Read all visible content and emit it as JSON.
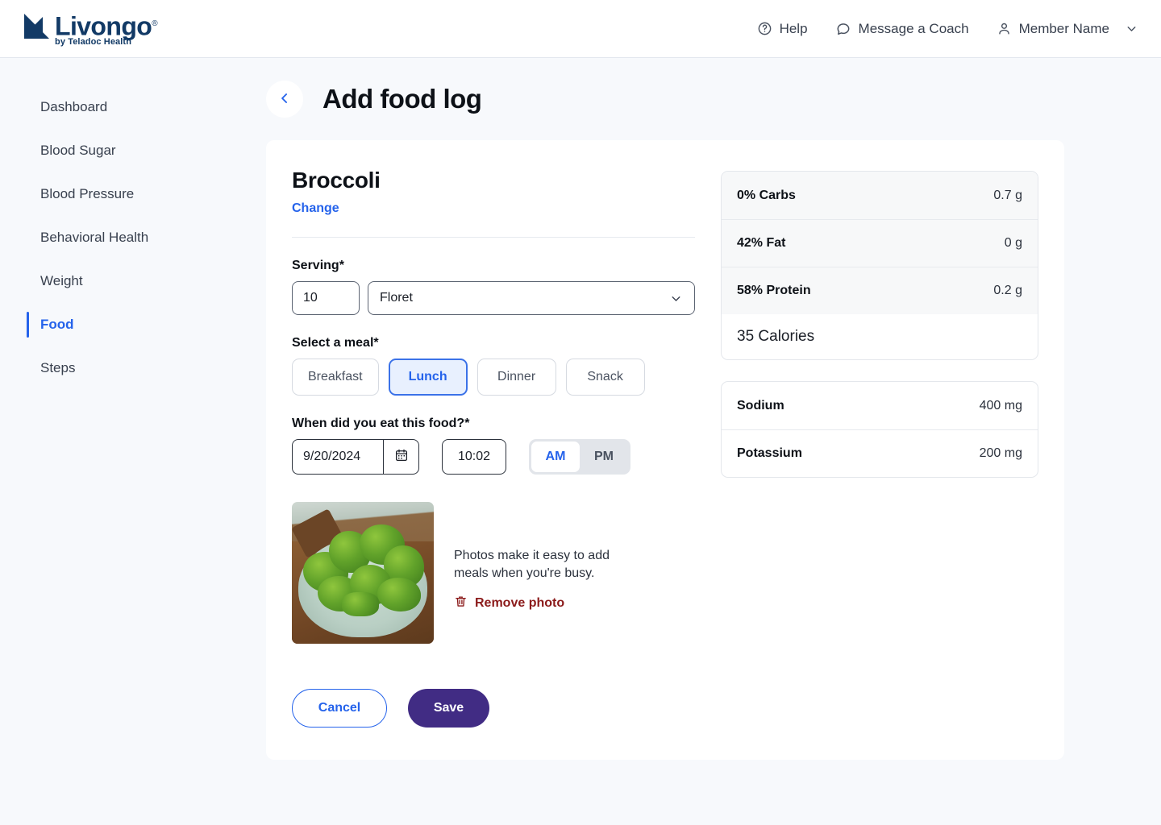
{
  "header": {
    "logo_word": "Livongo",
    "logo_reg": "®",
    "logo_sub": "by Teladoc Health",
    "nav": [
      {
        "label": "Help",
        "icon": "help-circle-icon"
      },
      {
        "label": "Message a Coach",
        "icon": "chat-bubble-icon"
      },
      {
        "label": "Member Name",
        "icon": "person-icon"
      }
    ]
  },
  "sidebar": {
    "items": [
      {
        "label": "Dashboard",
        "active": false
      },
      {
        "label": "Blood Sugar",
        "active": false
      },
      {
        "label": "Blood Pressure",
        "active": false
      },
      {
        "label": "Behavioral Health",
        "active": false
      },
      {
        "label": "Weight",
        "active": false
      },
      {
        "label": "Food",
        "active": true
      },
      {
        "label": "Steps",
        "active": false
      }
    ]
  },
  "page": {
    "title": "Add food log",
    "back_icon": "chevron-left-icon"
  },
  "form": {
    "food_name": "Broccoli",
    "change_label": "Change",
    "serving_label": "Serving*",
    "serving_qty": "10",
    "serving_unit": "Floret",
    "meal_label": "Select a meal*",
    "meals": [
      {
        "label": "Breakfast",
        "selected": false
      },
      {
        "label": "Lunch",
        "selected": true
      },
      {
        "label": "Dinner",
        "selected": false
      },
      {
        "label": "Snack",
        "selected": false
      }
    ],
    "when_label": "When did you eat this food?*",
    "date_value": "9/20/2024",
    "calendar_icon": "calendar-icon",
    "time_value": "10:02",
    "am_label": "AM",
    "pm_label": "PM",
    "meridiem_selected": "AM",
    "photo_hint": "Photos make it easy to add meals when you're busy.",
    "remove_photo_label": "Remove photo",
    "remove_photo_icon": "trash-icon",
    "photo_alt": "broccoli-bowl-photo",
    "cancel_label": "Cancel",
    "save_label": "Save"
  },
  "nutrition": {
    "macros": [
      {
        "key": "0% Carbs",
        "value": "0.7 g"
      },
      {
        "key": "42% Fat",
        "value": "0 g"
      },
      {
        "key": "58% Protein",
        "value": "0.2 g"
      }
    ],
    "calories": "35 Calories",
    "minerals": [
      {
        "key": "Sodium",
        "value": "400 mg"
      },
      {
        "key": "Potassium",
        "value": "200 mg"
      }
    ]
  },
  "colors": {
    "accent_blue": "#2563eb",
    "save_purple": "#412c84",
    "remove_red": "#8b1a1a",
    "logo_navy": "#123a66"
  }
}
